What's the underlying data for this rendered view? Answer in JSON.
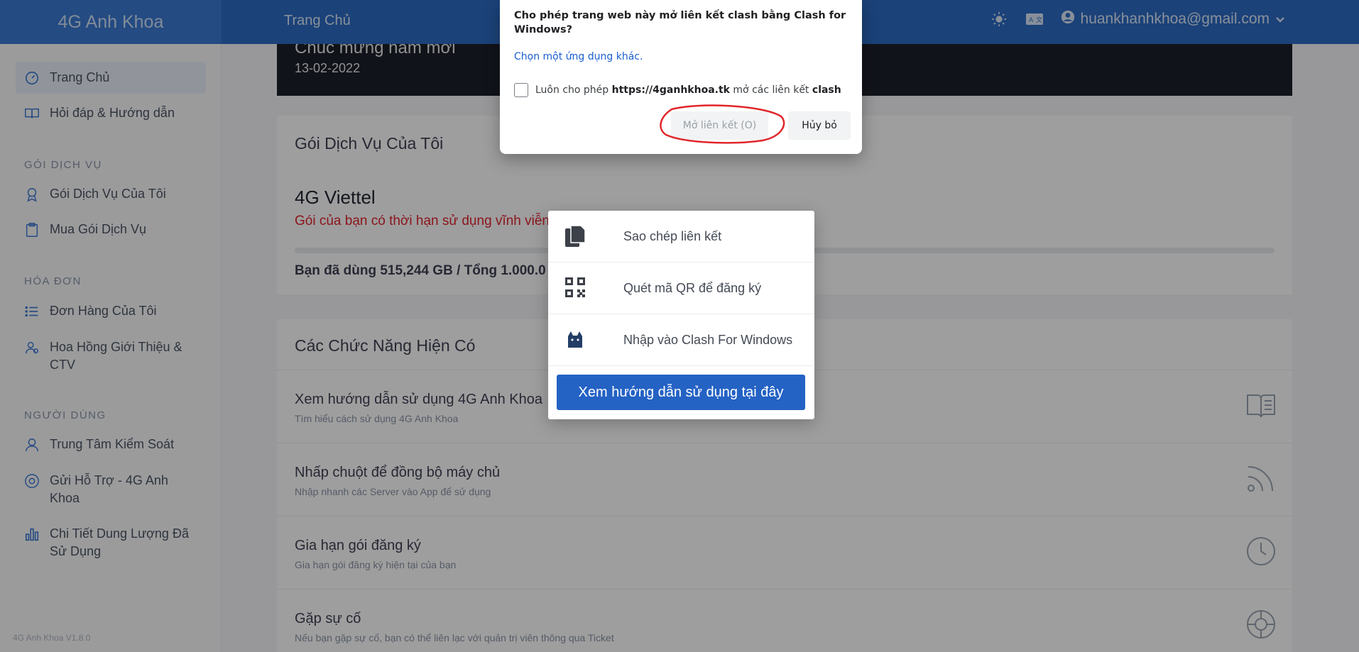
{
  "header": {
    "brand": "4G Anh Khoa",
    "home": "Trang Chủ",
    "user_email": "huankhanhkhoa@gmail.com"
  },
  "sidebar": {
    "items": [
      {
        "label": "Trang Chủ",
        "icon": "dashboard-icon",
        "active": true
      },
      {
        "label": "Hỏi đáp & Hướng dẫn",
        "icon": "book-icon"
      },
      {
        "label": "Gói Dịch Vụ Của Tôi",
        "icon": "award-icon"
      },
      {
        "label": "Mua Gói Dịch Vụ",
        "icon": "clipboard-icon"
      },
      {
        "label": "Đơn Hàng Của Tôi",
        "icon": "list-icon"
      },
      {
        "label": "Hoa Hồng Giới Thiệu & CTV",
        "icon": "users-icon"
      },
      {
        "label": "Trung Tâm Kiểm Soát",
        "icon": "user-icon"
      },
      {
        "label": "Gửi Hỗ Trợ - 4G Anh Khoa",
        "icon": "support-icon"
      },
      {
        "label": "Chi Tiết Dung Lượng Đã Sử Dụng",
        "icon": "bar-chart-icon"
      }
    ],
    "sections": [
      "GÓI DỊCH VỤ",
      "HÓA ĐƠN",
      "NGƯỜI DÙNG"
    ],
    "version": "4G Anh Khoa V1.8.0"
  },
  "banner": {
    "title": "Chúc mừng năm mới",
    "date": "13-02-2022"
  },
  "subscription": {
    "card_title": "Gói Dịch Vụ Của Tôi",
    "package_name": "4G Viettel",
    "note": "Gói của bạn có thời hạn sử dụng vĩnh viễn",
    "usage": "Bạn đã dùng 515,244 GB / Tổng 1.000.0"
  },
  "features": {
    "card_title": "Các Chức Năng Hiện Có",
    "items": [
      {
        "title": "Xem hướng dẫn sử dụng 4G Anh Khoa",
        "subtitle": "Tìm hiểu cách sử dụng 4G Anh Khoa",
        "icon": "book-open-icon"
      },
      {
        "title": "Nhấp chuột để đồng bộ máy chủ",
        "subtitle": "Nhập nhanh các Server vào App để sử dụng",
        "icon": "rss-icon"
      },
      {
        "title": "Gia hạn gói đăng ký",
        "subtitle": "Gia hạn gói đăng ký hiện tại của bạn",
        "icon": "clock-icon"
      },
      {
        "title": "Gặp sự cố",
        "subtitle": "Nếu bạn gặp sự cố, bạn có thể liên lạc với quản trị viên thông qua Ticket",
        "icon": "lifebuoy-icon"
      }
    ]
  },
  "popup_menu": {
    "items": [
      {
        "label": "Sao chép liên kết",
        "icon": "copy-icon"
      },
      {
        "label": "Quét mã QR để đăng ký",
        "icon": "qr-code-icon"
      },
      {
        "label": "Nhập vào Clash For Windows",
        "icon": "cat-icon"
      }
    ],
    "button": "Xem hướng dẫn sử dụng tại đây"
  },
  "dialog": {
    "title": "Cho phép trang web này mở liên kết clash bằng Clash for Windows?",
    "choose_other": "Chọn một ứng dụng khác.",
    "always_allow_prefix": "Luôn cho phép",
    "always_allow_site": "https://4ganhkhoa.tk",
    "always_allow_middle": "mở các liên kết",
    "always_allow_scheme": "clash",
    "open_button": "Mở liên kết (O)",
    "cancel_button": "Hủy bỏ"
  },
  "colors": {
    "header_blue": "#2d6bc4",
    "accent_blue": "#2462c4",
    "warning_red": "#e0242f",
    "highlight_red": "#e0262a"
  }
}
